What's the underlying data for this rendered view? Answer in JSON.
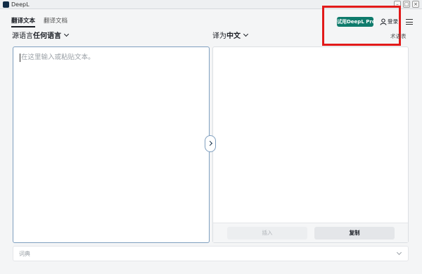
{
  "window": {
    "title": "DeepL",
    "controls": {
      "minimize": "–",
      "maximize": "□",
      "close": "×"
    }
  },
  "tabs": [
    {
      "label": "翻译文本",
      "active": true
    },
    {
      "label": "翻译文档",
      "active": false
    }
  ],
  "header": {
    "try_pro_label": "试用DeepL Pro",
    "login_label": "登录",
    "icons": {
      "login": "user-icon",
      "menu": "hamburger-menu-icon"
    }
  },
  "source": {
    "label": "源语言",
    "value": "任何语言",
    "placeholder": "在这里输入或粘贴文本。",
    "text": ""
  },
  "target": {
    "label": "译为",
    "value": "中文",
    "glossary_label": "术语表",
    "insert_label": "插入",
    "copy_label": "复制"
  },
  "swap": {
    "icon": "chevron-right-icon"
  },
  "dictionary": {
    "label": "词典",
    "icon": "chevron-down-icon"
  },
  "colors": {
    "brand": "#0f2b46",
    "pro_button": "#0f7b6c",
    "active_border": "#7f9fbf",
    "highlight": "#e21a1a"
  }
}
